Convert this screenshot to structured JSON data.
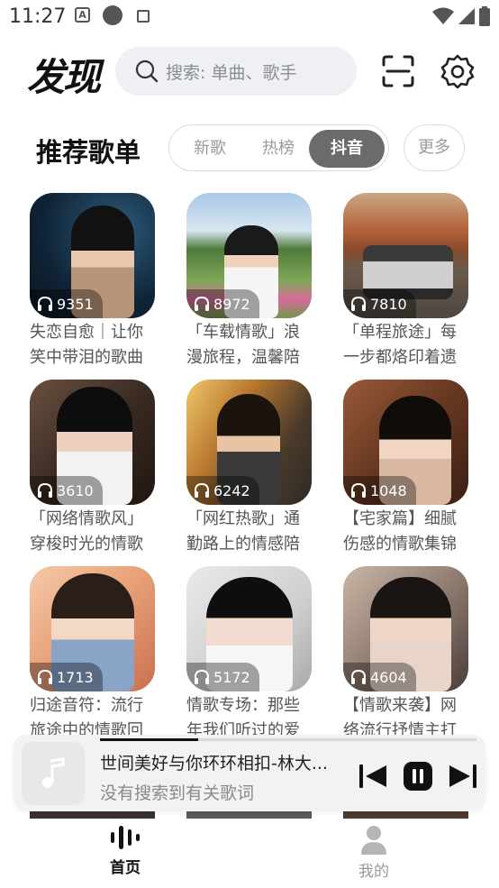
{
  "status_bar": {
    "time": "11:27"
  },
  "header": {
    "title": "发现",
    "search_placeholder": "搜索: 单曲、歌手",
    "icons": [
      "scan-icon",
      "settings-icon"
    ]
  },
  "section": {
    "title": "推荐歌单",
    "tabs": [
      "新歌",
      "热榜",
      "抖音"
    ],
    "active_tab": "抖音",
    "more_label": "更多"
  },
  "playlists": [
    {
      "count": "9351",
      "title": "失恋自愈｜让你笑中带泪的歌曲"
    },
    {
      "count": "8972",
      "title": "「车载情歌」浪漫旅程，温馨陪伴"
    },
    {
      "count": "7810",
      "title": "「单程旅途」每一步都烙印着遗憾"
    },
    {
      "count": "3610",
      "title": "「网络情歌风」穿梭时光的情歌"
    },
    {
      "count": "6242",
      "title": "「网红热歌」通勤路上的情感陪伴"
    },
    {
      "count": "1048",
      "title": "【宅家篇】细腻伤感的情歌集锦"
    },
    {
      "count": "1713",
      "title": "归途音符：流行旅途中的情歌回忆"
    },
    {
      "count": "5172",
      "title": "情歌专场：那些年我们听过的爱情"
    },
    {
      "count": "4604",
      "title": "【情歌来袭】网络流行抒情主打"
    }
  ],
  "player": {
    "song": "世间美好与你环环相扣-林大...",
    "lyric": "没有搜索到有关歌词",
    "progress": 0.26
  },
  "nav": {
    "home": "首页",
    "mine": "我的",
    "active": "首页"
  },
  "colors": {
    "active_tab_bg": "#6b6b6b",
    "search_bg": "#eef0f4",
    "player_bg": "#f2f2f2"
  }
}
